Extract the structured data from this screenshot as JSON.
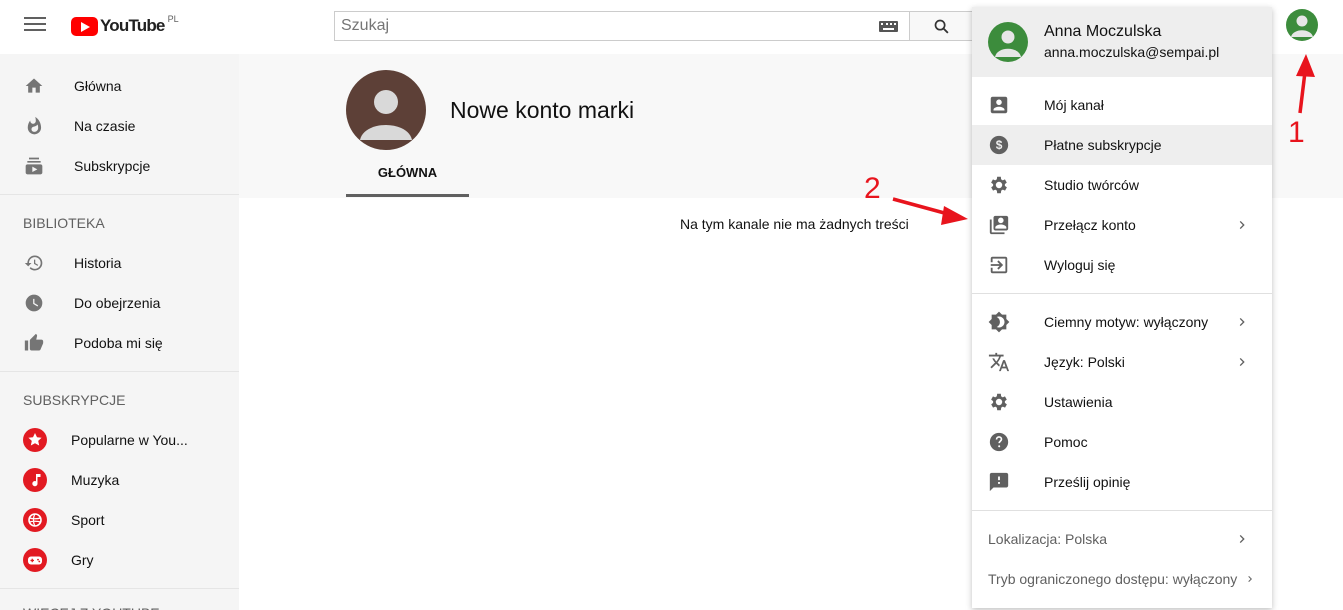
{
  "header": {
    "logo_text": "YouTube",
    "logo_region": "PL",
    "search_placeholder": "Szukaj"
  },
  "sidebar": {
    "main_items": [
      {
        "label": "Główna",
        "icon": "home-icon"
      },
      {
        "label": "Na czasie",
        "icon": "fire-icon"
      },
      {
        "label": "Subskrypcje",
        "icon": "subscriptions-icon"
      }
    ],
    "library_title": "BIBLIOTEKA",
    "library_items": [
      {
        "label": "Historia",
        "icon": "history-icon"
      },
      {
        "label": "Do obejrzenia",
        "icon": "clock-icon"
      },
      {
        "label": "Podoba mi się",
        "icon": "thumb-up-icon"
      }
    ],
    "subs_title": "SUBSKRYPCJE",
    "subs_items": [
      {
        "label": "Popularne w You...",
        "icon": "star-icon"
      },
      {
        "label": "Muzyka",
        "icon": "music-icon"
      },
      {
        "label": "Sport",
        "icon": "ball-icon"
      },
      {
        "label": "Gry",
        "icon": "gamepad-icon"
      }
    ],
    "more_title": "WIĘCEJ Z YOUTUBE"
  },
  "channel": {
    "name": "Nowe konto marki",
    "tab": "GŁÓWNA",
    "empty_message": "Na tym kanale nie ma żadnych treści"
  },
  "account_menu": {
    "user_name": "Anna Moczulska",
    "user_email": "anna.moczulska@sempai.pl",
    "items_group1": [
      {
        "label": "Mój kanał",
        "icon": "account-box-icon",
        "chevron": false
      },
      {
        "label": "Płatne subskrypcje",
        "icon": "dollar-icon",
        "chevron": false
      },
      {
        "label": "Studio twórców",
        "icon": "gear-icon",
        "chevron": false
      },
      {
        "label": "Przełącz konto",
        "icon": "switch-account-icon",
        "chevron": true
      },
      {
        "label": "Wyloguj się",
        "icon": "logout-icon",
        "chevron": false
      }
    ],
    "items_group2": [
      {
        "label": "Ciemny motyw: wyłączony",
        "icon": "dark-theme-icon",
        "chevron": true
      },
      {
        "label": "Język: Polski",
        "icon": "translate-icon",
        "chevron": true
      },
      {
        "label": "Ustawienia",
        "icon": "gear-icon",
        "chevron": false
      },
      {
        "label": "Pomoc",
        "icon": "help-icon",
        "chevron": false
      },
      {
        "label": "Prześlij opinię",
        "icon": "feedback-icon",
        "chevron": false
      }
    ],
    "footer_items": [
      {
        "label": "Lokalizacja: Polska"
      },
      {
        "label": "Tryb ograniczonego dostępu: wyłączony"
      }
    ]
  },
  "annotations": {
    "label_1": "1",
    "label_2": "2",
    "color": "#e8141d"
  }
}
